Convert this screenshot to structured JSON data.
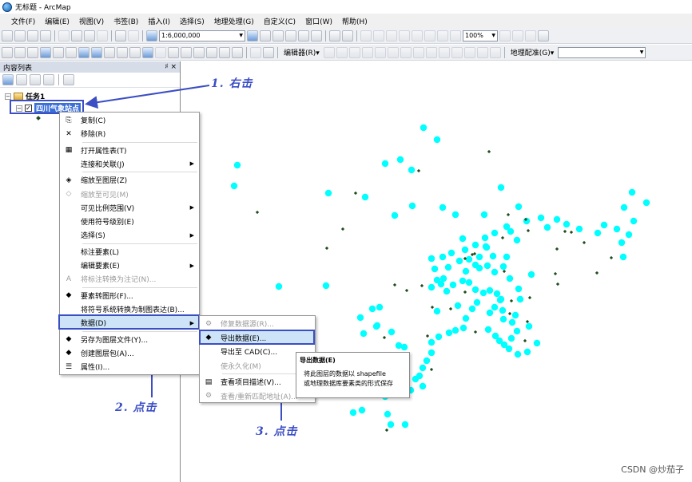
{
  "window": {
    "title": "无标题 - ArcMap"
  },
  "menu": [
    "文件(F)",
    "编辑(E)",
    "视图(V)",
    "书签(B)",
    "插入(I)",
    "选择(S)",
    "地理处理(G)",
    "自定义(C)",
    "窗口(W)",
    "帮助(H)"
  ],
  "toolbar": {
    "scale": "1:6,000,000",
    "zoom_percent": "100%",
    "editor_label": "编辑器(R)▾",
    "georef_label": "地理配准(G)▾"
  },
  "toc": {
    "title": "内容列表",
    "pin": "♯ ×",
    "group_name": "任务1",
    "layer_name": "四川气象站点"
  },
  "context_menu": [
    {
      "label": "复制(C)",
      "icon": "copy-icon",
      "enabled": true,
      "submenu": false
    },
    {
      "label": "移除(R)",
      "icon": "remove-icon",
      "enabled": true,
      "submenu": false
    },
    {
      "label": "打开属性表(T)",
      "icon": "table-icon",
      "enabled": true,
      "submenu": false
    },
    {
      "label": "连接和关联(J)",
      "icon": "",
      "enabled": true,
      "submenu": true
    },
    {
      "label": "缩放至图层(Z)",
      "icon": "zoom-layer-icon",
      "enabled": true,
      "submenu": false
    },
    {
      "label": "缩放至可见(M)",
      "icon": "zoom-visible-icon",
      "enabled": false,
      "submenu": false
    },
    {
      "label": "可见比例范围(V)",
      "icon": "",
      "enabled": true,
      "submenu": true
    },
    {
      "label": "使用符号级别(E)",
      "icon": "",
      "enabled": true,
      "submenu": false
    },
    {
      "label": "选择(S)",
      "icon": "",
      "enabled": true,
      "submenu": true
    },
    {
      "label": "标注要素(L)",
      "icon": "",
      "enabled": true,
      "submenu": false
    },
    {
      "label": "编辑要素(E)",
      "icon": "",
      "enabled": true,
      "submenu": true
    },
    {
      "label": "将标注转换为注记(N)...",
      "icon": "annotation-icon",
      "enabled": false,
      "submenu": false
    },
    {
      "label": "要素转图形(F)...",
      "icon": "graphics-icon",
      "enabled": true,
      "submenu": false
    },
    {
      "label": "将符号系统转换为制图表达(B)...",
      "icon": "",
      "enabled": true,
      "submenu": false
    },
    {
      "label": "数据(D)",
      "icon": "",
      "enabled": true,
      "submenu": true
    },
    {
      "label": "另存为图层文件(Y)...",
      "icon": "layer-file-icon",
      "enabled": true,
      "submenu": false
    },
    {
      "label": "创建图层包(A)...",
      "icon": "layer-package-icon",
      "enabled": true,
      "submenu": false
    },
    {
      "label": "属性(I)...",
      "icon": "properties-icon",
      "enabled": true,
      "submenu": false
    }
  ],
  "data_submenu": [
    {
      "label": "修复数据源(R)...",
      "icon": "repair-icon",
      "enabled": false
    },
    {
      "label": "导出数据(E)...",
      "icon": "export-icon",
      "enabled": true
    },
    {
      "label": "导出至 CAD(C)...",
      "icon": "",
      "enabled": true
    },
    {
      "label": "使永久化(M)",
      "icon": "",
      "enabled": false
    },
    {
      "label": "查看项目描述(V)...",
      "icon": "description-icon",
      "enabled": true
    },
    {
      "label": "查看/重新匹配地址(A)...",
      "icon": "geocode-icon",
      "enabled": false
    }
  ],
  "tooltip": {
    "title": "导出数据(E)",
    "line1": "将此图层的数据以 shapefile",
    "line2": "或地理数据库要素类的形式保存"
  },
  "annotations": {
    "step1": "1. 右击",
    "step2": "2. 点击",
    "step3": "3. 点击"
  },
  "watermark": "CSDN @炒茄子",
  "colors": {
    "station_cyan": "#00ffff",
    "station_dark": "#1f4d1f",
    "annotation_blue": "#3b4ec4",
    "highlight": "#cce3f8"
  }
}
